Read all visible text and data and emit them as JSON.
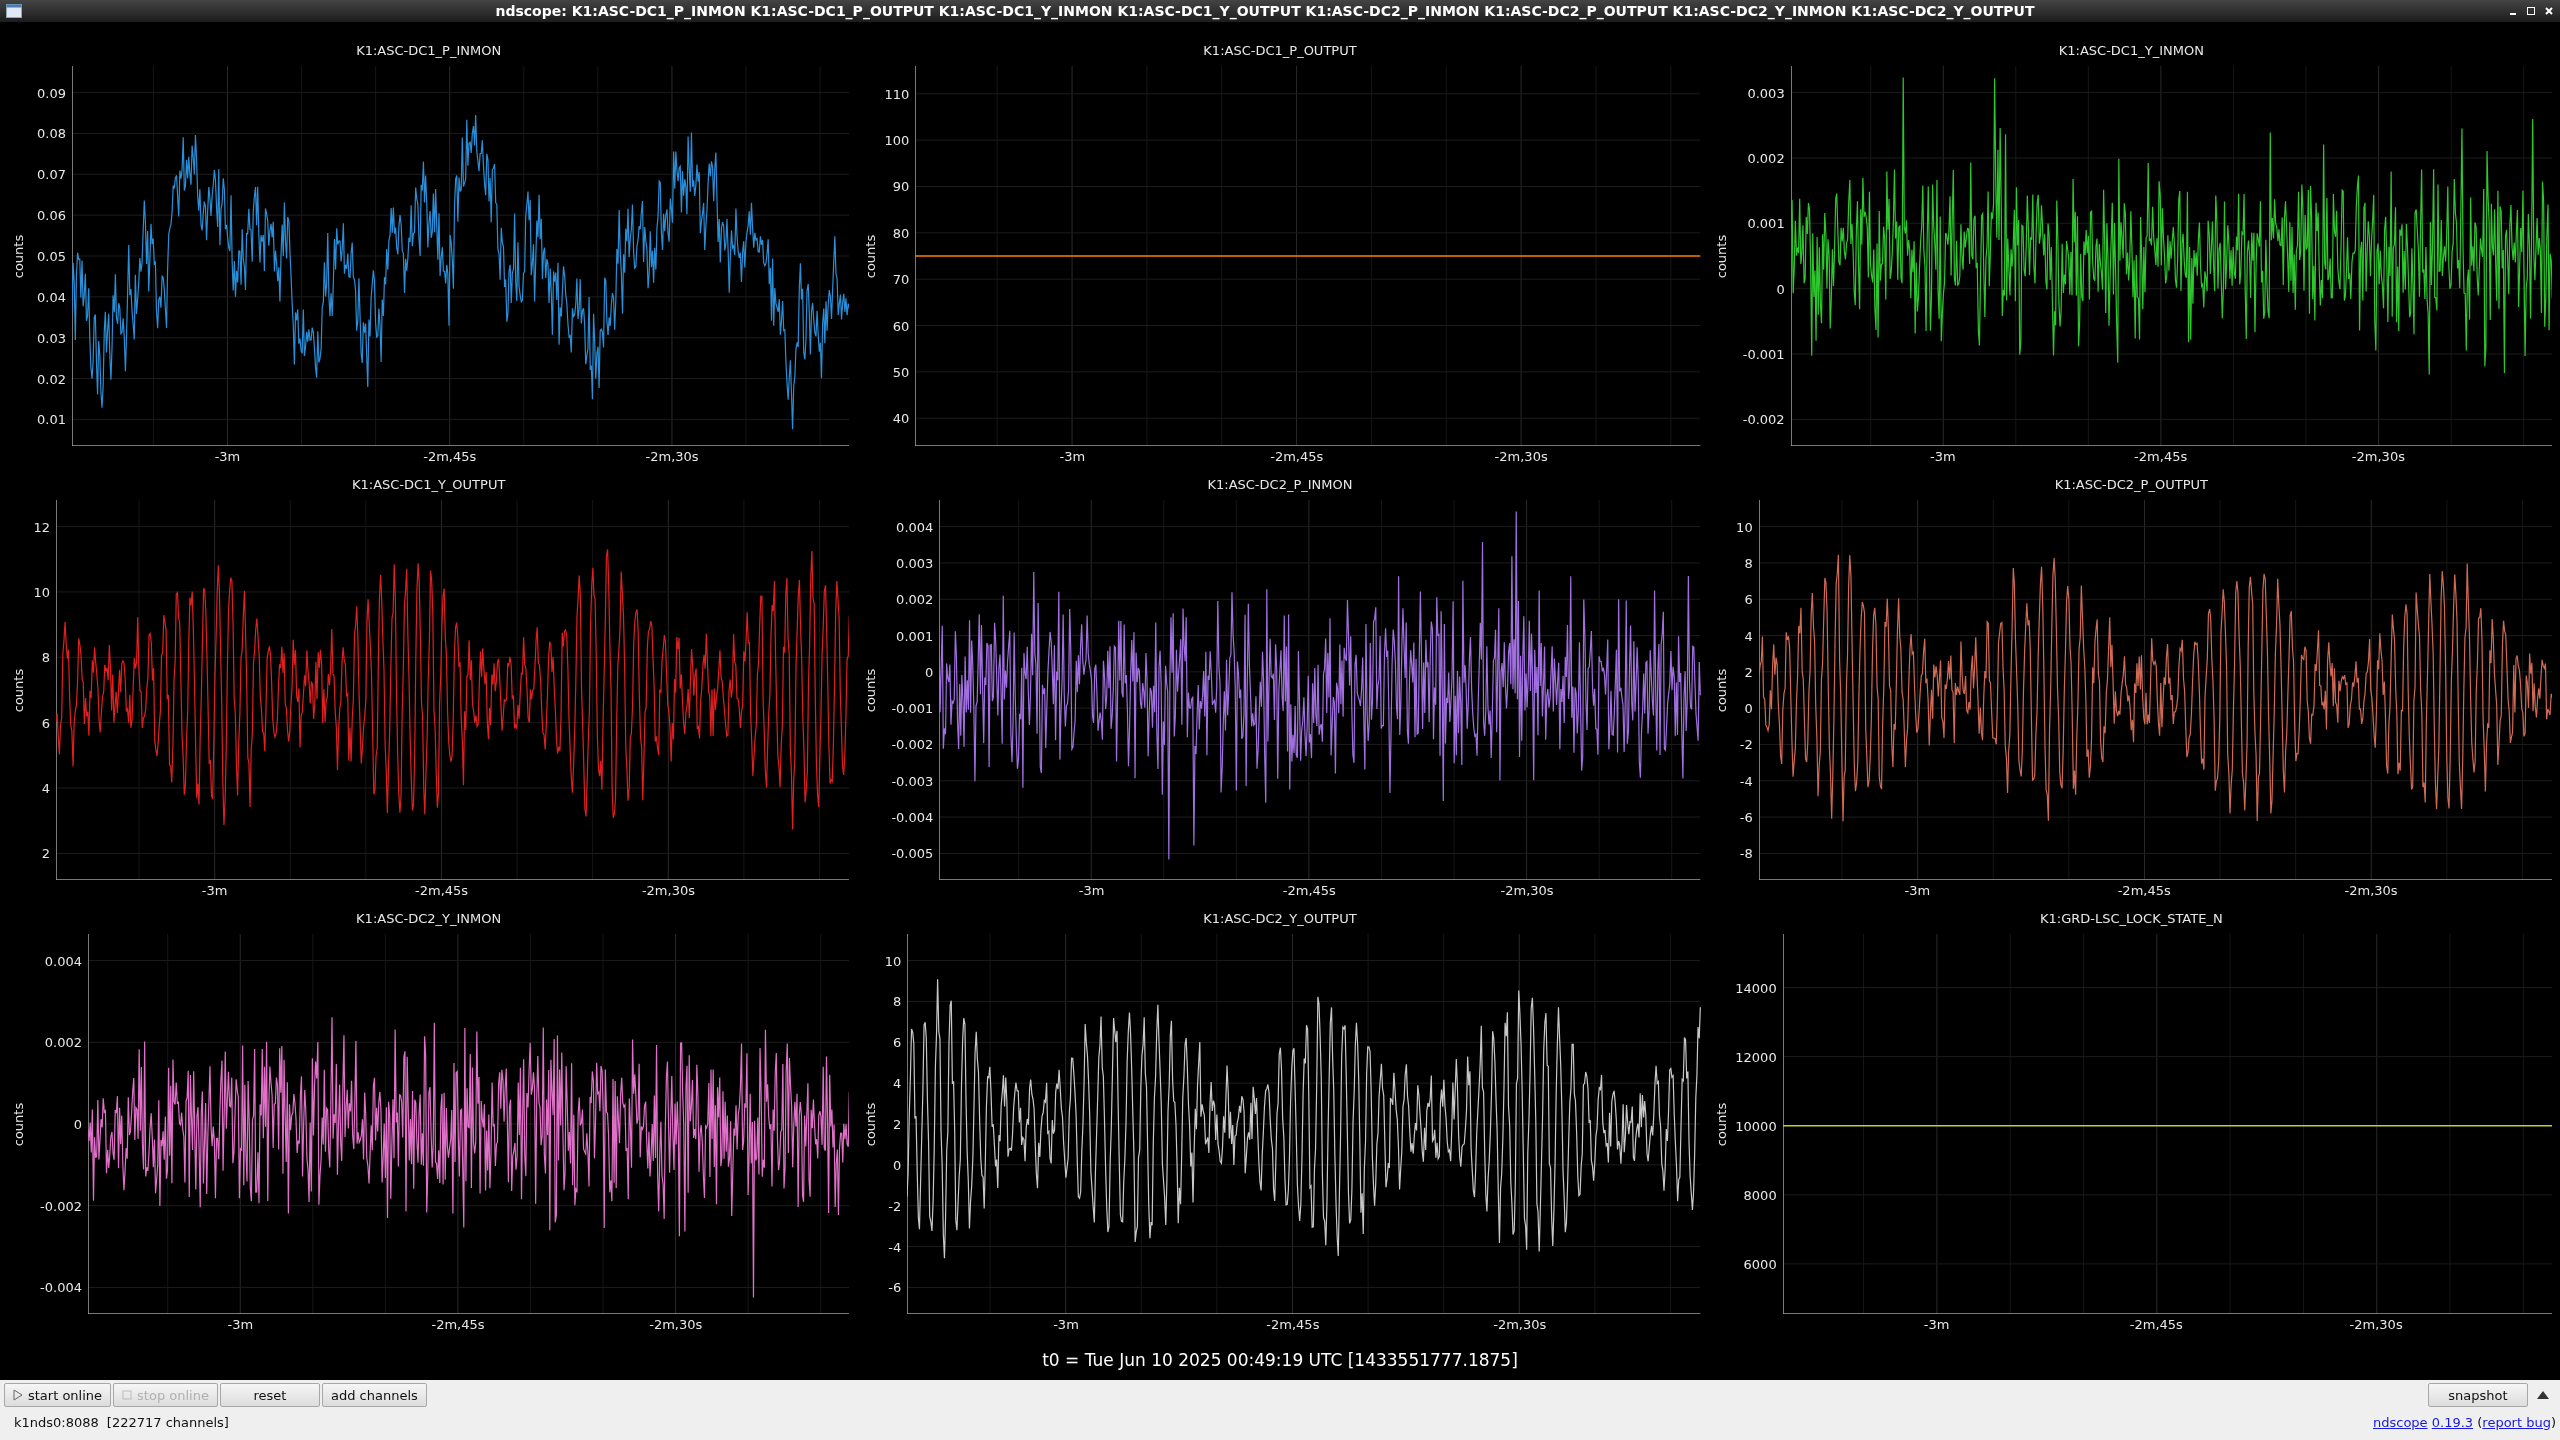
{
  "window": {
    "title": "ndscope: K1:ASC-DC1_P_INMON K1:ASC-DC1_P_OUTPUT K1:ASC-DC1_Y_INMON K1:ASC-DC1_Y_OUTPUT K1:ASC-DC2_P_INMON K1:ASC-DC2_P_OUTPUT K1:ASC-DC2_Y_INMON K1:ASC-DC2_Y_OUTPUT"
  },
  "plots": [
    {
      "title": "K1:ASC-DC1_P_INMON",
      "ylabel": "counts",
      "yticks": [
        "0.09",
        "0.08",
        "0.07",
        "0.06",
        "0.05",
        "0.04",
        "0.03",
        "0.02",
        "0.01"
      ],
      "xticks": [
        "-3m",
        "-2m,45s",
        "-2m,30s"
      ],
      "trace": {
        "kind": "wander",
        "color": "#2a8fd8"
      }
    },
    {
      "chart_data": {
        "type": "line",
        "ylabel": "counts",
        "grid": true,
        "categories": [
          null,
          null,
          null,
          null,
          null,
          null,
          null,
          "-3m",
          null,
          null,
          null,
          null,
          null,
          null,
          null,
          null,
          null,
          "-2m,45s",
          null,
          null,
          null,
          null,
          null,
          null,
          null,
          null,
          null,
          "-2m,30s",
          null,
          null,
          null,
          null,
          null,
          null,
          null,
          null
        ],
        "ylim": [
          34,
          116
        ],
        "yticks": [
          110,
          100,
          90,
          80,
          70,
          60,
          50,
          40
        ],
        "series": [
          {
            "name": "K1:ASC-DC1_P_OUTPUT",
            "color": "#ff8000",
            "values": [
              75,
              75,
              75,
              75,
              75,
              75,
              75,
              75,
              75,
              75,
              75,
              75,
              75,
              75,
              75,
              75,
              75,
              75,
              75,
              75,
              75,
              75,
              75,
              75,
              75,
              75,
              75,
              75,
              75,
              75,
              75,
              75,
              75,
              75,
              75,
              75
            ]
          }
        ]
      }
    },
    {
      "title": "K1:ASC-DC1_Y_INMON",
      "ylabel": "counts",
      "yticks": [
        "0.003",
        "0.002",
        "0.001",
        "0",
        "-0.001",
        "-0.002"
      ],
      "xticks": [
        "-3m",
        "-2m,45s",
        "-2m,30s"
      ],
      "trace": {
        "kind": "noise",
        "color": "#2ec82e"
      }
    },
    {
      "title": "K1:ASC-DC1_Y_OUTPUT",
      "ylabel": "counts",
      "yticks": [
        "12",
        "10",
        "8",
        "6",
        "4",
        "2"
      ],
      "xticks": [
        "-3m",
        "-2m,45s",
        "-2m,30s"
      ],
      "trace": {
        "kind": "oscillation",
        "color": "#e02020"
      }
    },
    {
      "title": "K1:ASC-DC2_P_INMON",
      "ylabel": "counts",
      "yticks": [
        "0.004",
        "0.003",
        "0.002",
        "0.001",
        "0",
        "-0.001",
        "-0.002",
        "-0.003",
        "-0.004",
        "-0.005"
      ],
      "xticks": [
        "-3m",
        "-2m,45s",
        "-2m,30s"
      ],
      "trace": {
        "kind": "noise",
        "color": "#a070e0"
      }
    },
    {
      "title": "K1:ASC-DC2_P_OUTPUT",
      "ylabel": "counts",
      "yticks": [
        "10",
        "8",
        "6",
        "4",
        "2",
        "0",
        "-2",
        "-4",
        "-6",
        "-8"
      ],
      "xticks": [
        "-3m",
        "-2m,45s",
        "-2m,30s"
      ],
      "trace": {
        "kind": "oscillation",
        "color": "#d06a55"
      }
    },
    {
      "title": "K1:ASC-DC2_Y_INMON",
      "ylabel": "counts",
      "yticks": [
        "0.004",
        "0.002",
        "0",
        "-0.002",
        "-0.004"
      ],
      "xticks": [
        "-3m",
        "-2m,45s",
        "-2m,30s"
      ],
      "trace": {
        "kind": "noise",
        "color": "#e070c8"
      }
    },
    {
      "title": "K1:ASC-DC2_Y_OUTPUT",
      "ylabel": "counts",
      "yticks": [
        "10",
        "8",
        "6",
        "4",
        "2",
        "0",
        "-2",
        "-4",
        "-6"
      ],
      "xticks": [
        "-3m",
        "-2m,45s",
        "-2m,30s"
      ],
      "trace": {
        "kind": "oscillation",
        "color": "#c8c8c8"
      }
    },
    {
      "chart_data": {
        "type": "line",
        "ylabel": "counts",
        "grid": true,
        "categories": [
          null,
          null,
          null,
          null,
          null,
          null,
          null,
          "-3m",
          null,
          null,
          null,
          null,
          null,
          null,
          null,
          null,
          null,
          "-2m,45s",
          null,
          null,
          null,
          null,
          null,
          null,
          null,
          null,
          null,
          "-2m,30s",
          null,
          null,
          null,
          null,
          null,
          null,
          null,
          null
        ],
        "ylim": [
          4550,
          15550
        ],
        "yticks": [
          14000,
          12000,
          10000,
          8000,
          6000
        ],
        "series": [
          {
            "name": "K1:GRD-LSC_LOCK_STATE_N",
            "color": "#c8c832",
            "values": [
              10000,
              10000,
              10000,
              10000,
              10000,
              10000,
              10000,
              10000,
              10000,
              10000,
              10000,
              10000,
              10000,
              10000,
              10000,
              10000,
              10000,
              10000,
              10000,
              10000,
              10000,
              10000,
              10000,
              10000,
              10000,
              10000,
              10000,
              10000,
              10000,
              10000,
              10000,
              10000,
              10000,
              10000,
              10000,
              10000
            ]
          }
        ]
      }
    }
  ],
  "t0": "t0 = Tue Jun 10 2025 00:49:19 UTC [1433551777.1875]",
  "buttons": [
    {
      "label": "start online",
      "kind": "play",
      "disabled": false
    },
    {
      "label": "stop online",
      "kind": "stop",
      "disabled": true
    },
    {
      "label": "reset",
      "kind": "plain",
      "disabled": false
    },
    {
      "label": "add channels",
      "kind": "plain",
      "disabled": false
    }
  ],
  "snapshot": "snapshot",
  "status": {
    "server": "k1nds0:8088",
    "channels": "[222717 channels]"
  },
  "version_line": {
    "app": "ndscope",
    "version": "0.19.3",
    "open": "(",
    "bug": "report bug",
    "close": ")"
  }
}
